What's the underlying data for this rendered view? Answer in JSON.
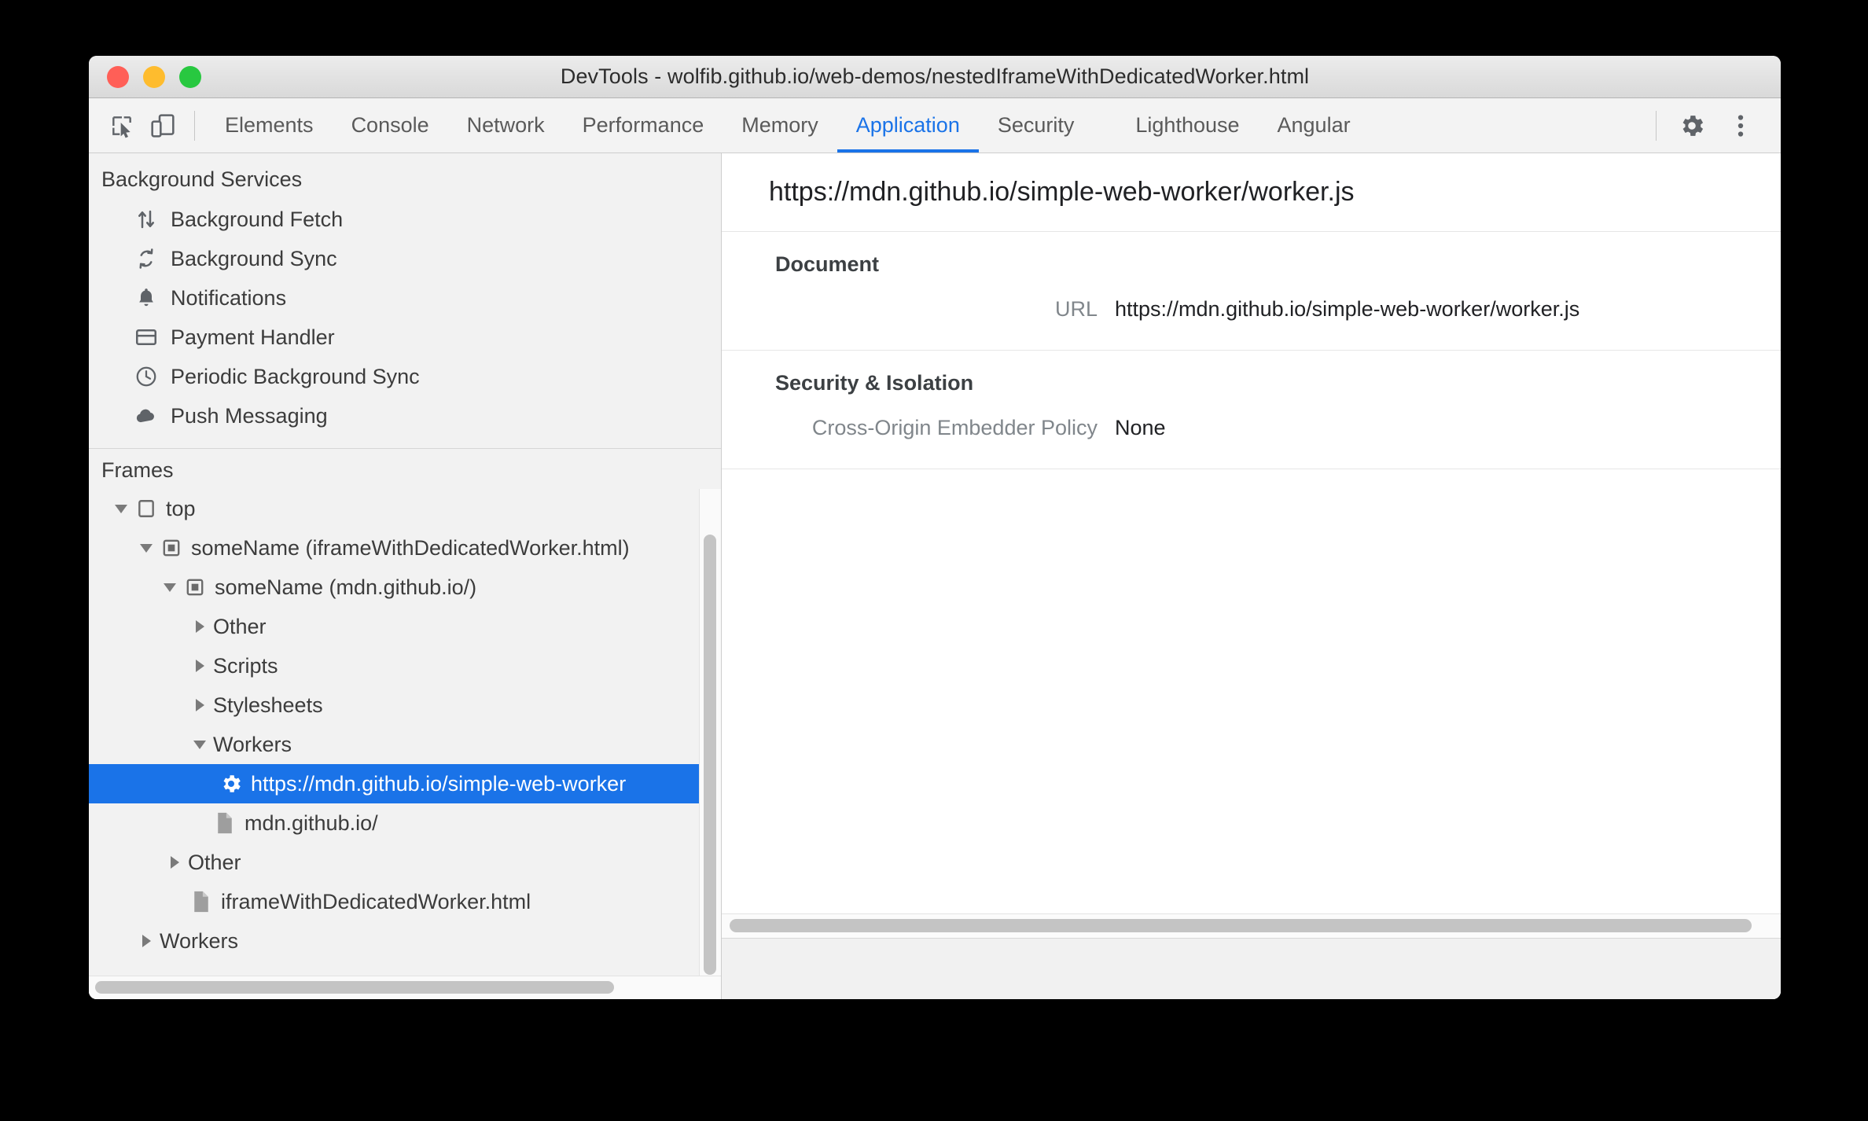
{
  "window": {
    "title": "DevTools - wolfib.github.io/web-demos/nestedIframeWithDedicatedWorker.html",
    "controls": [
      {
        "name": "close",
        "color": "#ff5f57"
      },
      {
        "name": "minimize",
        "color": "#febc2e"
      },
      {
        "name": "maximize",
        "color": "#28c840"
      }
    ]
  },
  "toolbar": {
    "inspect_icon": "inspect-element-icon",
    "device_icon": "device-toolbar-icon",
    "settings_icon": "gear-icon",
    "more_icon": "kebab-menu-icon",
    "accent_color": "#1a73e8"
  },
  "tabs": [
    {
      "label": "Elements",
      "active": false
    },
    {
      "label": "Console",
      "active": false
    },
    {
      "label": "Network",
      "active": false
    },
    {
      "label": "Performance",
      "active": false
    },
    {
      "label": "Memory",
      "active": false
    },
    {
      "label": "Application",
      "active": true
    },
    {
      "label": "Security",
      "active": false
    },
    {
      "label": "Lighthouse",
      "active": false
    },
    {
      "label": "Angular",
      "active": false
    }
  ],
  "sidebar": {
    "background_services": {
      "title": "Background Services",
      "items": [
        {
          "label": "Background Fetch",
          "icon": "arrows-up-down-icon"
        },
        {
          "label": "Background Sync",
          "icon": "sync-icon"
        },
        {
          "label": "Notifications",
          "icon": "bell-icon"
        },
        {
          "label": "Payment Handler",
          "icon": "credit-card-icon"
        },
        {
          "label": "Periodic Background Sync",
          "icon": "clock-icon"
        },
        {
          "label": "Push Messaging",
          "icon": "cloud-icon"
        }
      ]
    },
    "frames": {
      "title": "Frames",
      "tree": [
        {
          "label": "top",
          "indent": 0,
          "twisty": "open",
          "icon": "frame-icon",
          "selected": false
        },
        {
          "label": "someName (iframeWithDedicatedWorker.html)",
          "indent": 1,
          "twisty": "open",
          "icon": "iframe-icon",
          "selected": false
        },
        {
          "label": "someName (mdn.github.io/)",
          "indent": 2,
          "twisty": "open",
          "icon": "iframe-icon",
          "selected": false
        },
        {
          "label": "Other",
          "indent": 3,
          "twisty": "closed",
          "icon": "none",
          "selected": false
        },
        {
          "label": "Scripts",
          "indent": 3,
          "twisty": "closed",
          "icon": "none",
          "selected": false
        },
        {
          "label": "Stylesheets",
          "indent": 3,
          "twisty": "closed",
          "icon": "none",
          "selected": false
        },
        {
          "label": "Workers",
          "indent": 3,
          "twisty": "open",
          "icon": "none",
          "selected": false
        },
        {
          "label": "https://mdn.github.io/simple-web-worker",
          "indent": 4,
          "twisty": "none",
          "icon": "worker-gear-icon",
          "selected": true
        },
        {
          "label": "mdn.github.io/",
          "indent": 3,
          "twisty": "none",
          "icon": "document-icon",
          "selected": false
        },
        {
          "label": "Other",
          "indent": 2,
          "twisty": "closed",
          "icon": "none",
          "selected": false
        },
        {
          "label": "iframeWithDedicatedWorker.html",
          "indent": 3,
          "twisty": "none",
          "icon": "document-icon",
          "selected": false
        },
        {
          "label": "Workers",
          "indent": 1,
          "twisty": "closed",
          "icon": "none",
          "selected": false
        }
      ]
    }
  },
  "main": {
    "header_url": "https://mdn.github.io/simple-web-worker/worker.js",
    "sections": [
      {
        "title": "Document",
        "fields": [
          {
            "name": "URL",
            "value": "https://mdn.github.io/simple-web-worker/worker.js"
          }
        ]
      },
      {
        "title": "Security & Isolation",
        "fields": [
          {
            "name": "Cross-Origin Embedder Policy",
            "value": "None"
          }
        ]
      }
    ]
  }
}
